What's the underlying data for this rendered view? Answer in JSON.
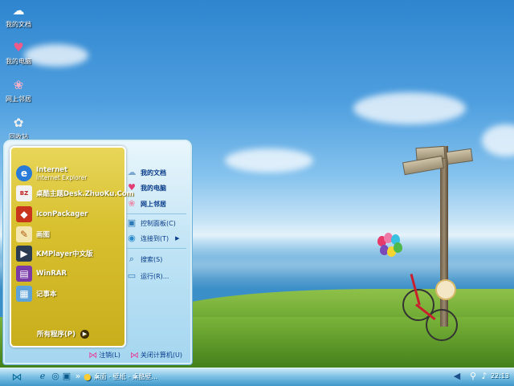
{
  "desktop_icons": [
    {
      "label": "我的文档",
      "icon": "folder-docs-icon"
    },
    {
      "label": "我的电脑",
      "icon": "heart-computer-icon"
    },
    {
      "label": "网上邻居",
      "icon": "network-icon"
    },
    {
      "label": "回收站",
      "icon": "recycle-bin-icon"
    }
  ],
  "start_menu": {
    "pinned": {
      "title": "Internet",
      "subtitle": "Internet Explorer"
    },
    "programs": [
      {
        "label": "桌酷主题Desk.ZhuoKu.Com",
        "icon": "zhuoku-icon"
      },
      {
        "label": "IconPackager",
        "icon": "iconpackager-icon"
      },
      {
        "label": "画图",
        "icon": "paint-icon"
      },
      {
        "label": "KMPlayer中文版",
        "icon": "kmplayer-icon"
      },
      {
        "label": "WinRAR",
        "icon": "winrar-icon"
      },
      {
        "label": "记事本",
        "icon": "notepad-icon"
      }
    ],
    "all_programs": "所有程序(P)",
    "right": {
      "my_docs": "我的文档",
      "my_computer": "我的电脑",
      "network": "网上邻居",
      "control_panel": "控制面板(C)",
      "connect_to": "连接到(T)",
      "search": "搜索(S)",
      "run": "运行(R)..."
    },
    "logoff": "注销(L)",
    "shutdown": "关闭计算机(U)"
  },
  "taskbar": {
    "quicklaunch_glyph": "»",
    "task_label": "桌面 - 壁纸 - 桌酷壁...",
    "clock": "22:13"
  }
}
